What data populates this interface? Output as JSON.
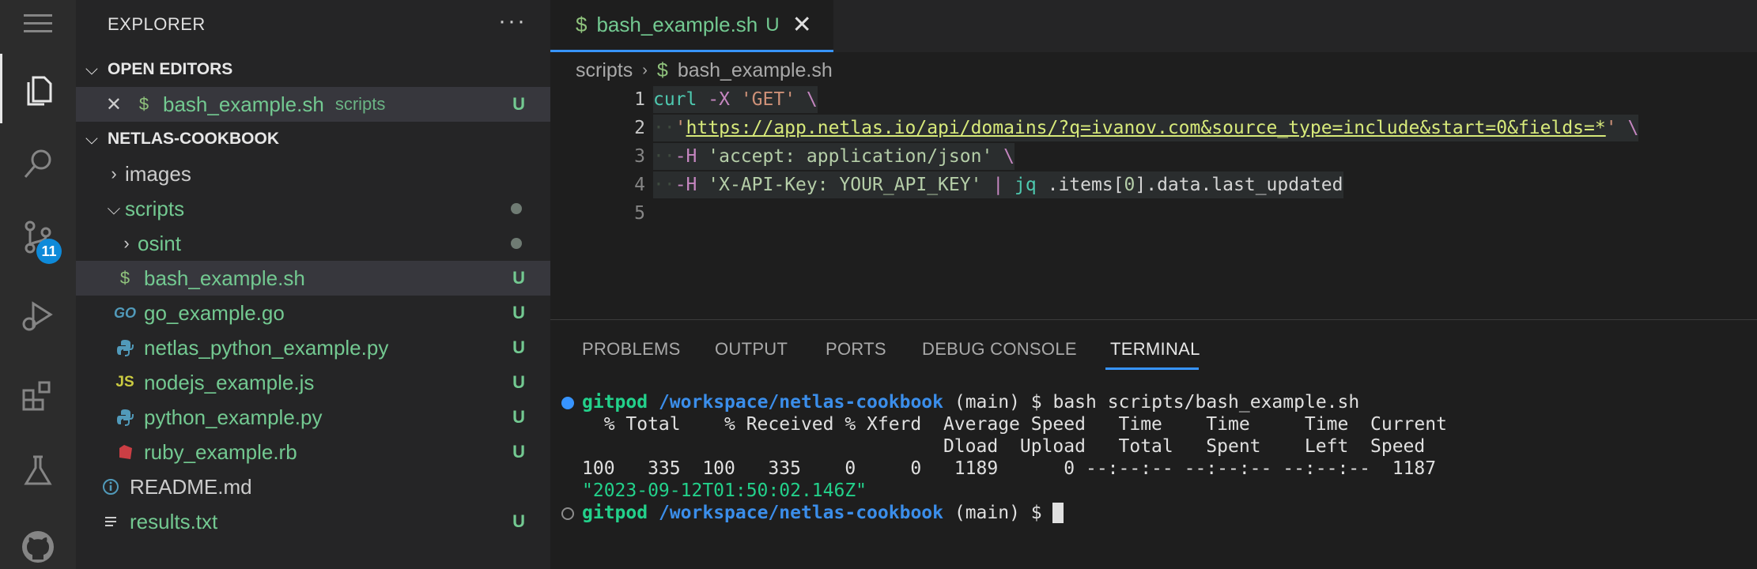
{
  "activity_bar": {
    "items": [
      {
        "icon": "files-icon",
        "active": true
      },
      {
        "icon": "search-icon"
      },
      {
        "icon": "source-control-icon",
        "badge": "11"
      },
      {
        "icon": "run-debug-icon"
      },
      {
        "icon": "extensions-icon"
      },
      {
        "icon": "testing-icon"
      },
      {
        "icon": "github-icon"
      }
    ]
  },
  "sidebar": {
    "title": "EXPLORER",
    "more_label": "···",
    "open_editors": {
      "header": "OPEN EDITORS",
      "items": [
        {
          "name": "bash_example.sh",
          "folder": "scripts",
          "status": "U"
        }
      ]
    },
    "project": {
      "header": "NETLAS-COOKBOOK",
      "tree": [
        {
          "name": "images",
          "status": ""
        },
        {
          "name": "scripts",
          "status": ""
        },
        {
          "name": "osint",
          "status": ""
        },
        {
          "name": "bash_example.sh",
          "status": "U"
        },
        {
          "name": "go_example.go",
          "status": "U"
        },
        {
          "name": "netlas_python_example.py",
          "status": "U"
        },
        {
          "name": "nodejs_example.js",
          "status": "U"
        },
        {
          "name": "python_example.py",
          "status": "U"
        },
        {
          "name": "ruby_example.rb",
          "status": "U"
        },
        {
          "name": "README.md",
          "status": ""
        },
        {
          "name": "results.txt",
          "status": "U"
        }
      ]
    }
  },
  "editor": {
    "tab": {
      "icon": "$",
      "name": "bash_example.sh",
      "status": "U",
      "close": "✕"
    },
    "breadcrumb": {
      "folder": "scripts",
      "separator": "›",
      "icon": "$",
      "file": "bash_example.sh"
    },
    "line_numbers": [
      "1",
      "2",
      "3",
      "4",
      "5"
    ],
    "code": {
      "l1": {
        "cmd": "curl",
        "opt": "-X",
        "str": "'GET'",
        "esc": "\\"
      },
      "l2": {
        "url_open": "'",
        "url": "https://app.netlas.io/api/domains/?q=ivanov.com&source_type=include&start=0&fields=*",
        "url_close": "'",
        "esc": "\\"
      },
      "l3": {
        "opt": "-H",
        "str": "'accept: application/json'",
        "esc": "\\"
      },
      "l4": {
        "opt": "-H",
        "str": "'X-API-Key: YOUR_API_KEY'",
        "pipe": "|",
        "cmd": "jq",
        "expr_a": ".items[",
        "expr_num": "0",
        "expr_b": "].data.last_updated"
      }
    }
  },
  "panel": {
    "tabs": [
      "PROBLEMS",
      "OUTPUT",
      "PORTS",
      "DEBUG CONSOLE",
      "TERMINAL"
    ],
    "active_tab": "TERMINAL",
    "terminal": {
      "prompt_user": "gitpod",
      "prompt_path": "/workspace/netlas-cookbook",
      "prompt_branch": "(main) $",
      "command": "bash scripts/bash_example.sh",
      "out1": "  % Total    % Received % Xferd  Average Speed   Time    Time     Time  Current",
      "out2": "                                 Dload  Upload   Total   Spent    Left  Speed",
      "out3": "100   335  100   335    0     0   1189      0 --:--:-- --:--:-- --:--:--  1187",
      "result": "\"2023-09-12T01:50:02.146Z\""
    }
  },
  "colors": {
    "accent": "#3794ff",
    "untracked": "#73c991",
    "badge": "#0e8ad9"
  }
}
